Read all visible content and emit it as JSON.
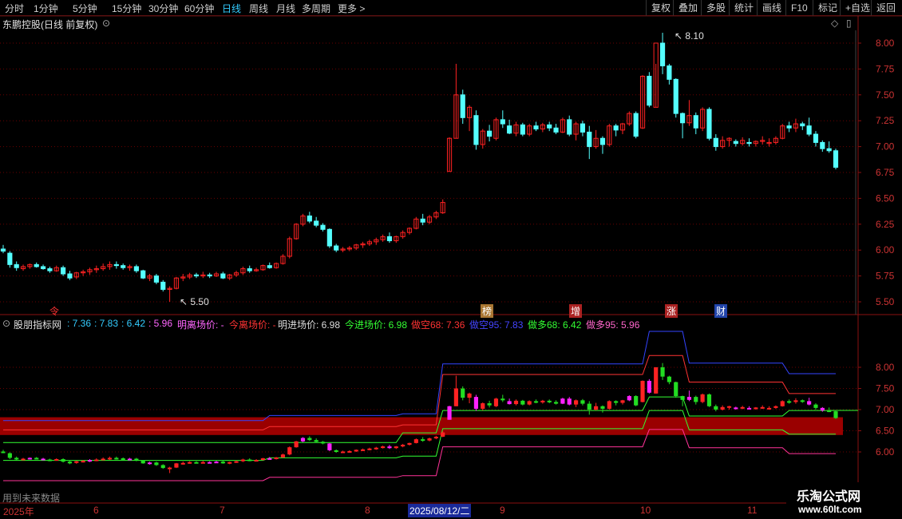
{
  "toolbar": {
    "periods": [
      "分时",
      "1分钟",
      "5分钟",
      "15分钟",
      "30分钟",
      "60分钟",
      "日线",
      "周线",
      "月线",
      "多周期",
      "更多 >"
    ],
    "active_period": "日线",
    "right_buttons": [
      "复权",
      "叠加",
      "多股",
      "统计",
      "画线",
      "F10",
      "标记",
      "+自选",
      "返回"
    ]
  },
  "main_title": "东鹏控股(日线 前复权)",
  "indicator": {
    "name": "股朋指标网",
    "v1": ": 7.36",
    "v2": ": 7.83",
    "v3": ": 6.42",
    "v4": ": 5.96",
    "items": [
      {
        "label": "明离场价: -",
        "color": "#ff66ff"
      },
      {
        "label": "今离场价: -",
        "color": "#ff3333"
      },
      {
        "label": "明进场价: 6.98",
        "color": "#dddddd"
      },
      {
        "label": "今进场价: 6.98",
        "color": "#33ff33"
      },
      {
        "label": "做空68: 7.36",
        "color": "#ff3333"
      },
      {
        "label": "做空95: 7.83",
        "color": "#4444ff"
      },
      {
        "label": "做多68: 6.42",
        "color": "#33ff33"
      },
      {
        "label": "做多95: 5.96",
        "color": "#ff66cc"
      }
    ]
  },
  "price_axis": [
    "8.00",
    "7.75",
    "7.50",
    "7.25",
    "7.00",
    "6.75",
    "6.50",
    "6.25",
    "6.00",
    "5.75",
    "5.50"
  ],
  "ind_axis": [
    "8.00",
    "7.50",
    "7.00",
    "6.50",
    "6.00"
  ],
  "annotations": {
    "high": "8.10",
    "low": "5.50"
  },
  "markers": [
    {
      "text": "令",
      "color": "#ff3333",
      "bg": ""
    },
    {
      "text": "榜",
      "color": "#ffffff",
      "bg": "#aa7733"
    },
    {
      "text": "增",
      "color": "#ffffff",
      "bg": "#aa2222"
    },
    {
      "text": "涨",
      "color": "#ffffff",
      "bg": "#aa2222"
    },
    {
      "text": "财",
      "color": "#ffffff",
      "bg": "#2244aa"
    }
  ],
  "future_note": "用到未来数据",
  "date_axis": [
    "2025年",
    "6",
    "7",
    "8",
    "2025/08/12/二",
    "9",
    "10",
    "11"
  ],
  "watermark": {
    "line1": "乐淘公式网",
    "line2": "www.60lt.com"
  },
  "colors": {
    "up": "#ff2222",
    "down": "#54ffff",
    "grid": "#6a0000",
    "band": "#9a0000",
    "active": "#33ccff"
  },
  "chart_data": {
    "type": "candlestick",
    "candles": [
      [
        6.01,
        6.05,
        5.97,
        5.99
      ],
      [
        5.97,
        5.99,
        5.83,
        5.86
      ],
      [
        5.86,
        5.89,
        5.8,
        5.83
      ],
      [
        5.82,
        5.86,
        5.8,
        5.84
      ],
      [
        5.84,
        5.87,
        5.82,
        5.86
      ],
      [
        5.86,
        5.88,
        5.83,
        5.84
      ],
      [
        5.84,
        5.86,
        5.81,
        5.82
      ],
      [
        5.82,
        5.84,
        5.78,
        5.8
      ],
      [
        5.8,
        5.85,
        5.79,
        5.83
      ],
      [
        5.83,
        5.85,
        5.75,
        5.77
      ],
      [
        5.77,
        5.8,
        5.71,
        5.73
      ],
      [
        5.74,
        5.79,
        5.72,
        5.78
      ],
      [
        5.78,
        5.81,
        5.75,
        5.79
      ],
      [
        5.79,
        5.83,
        5.76,
        5.81
      ],
      [
        5.81,
        5.85,
        5.78,
        5.82
      ],
      [
        5.82,
        5.87,
        5.8,
        5.84
      ],
      [
        5.84,
        5.89,
        5.81,
        5.86
      ],
      [
        5.86,
        5.89,
        5.82,
        5.85
      ],
      [
        5.85,
        5.87,
        5.81,
        5.83
      ],
      [
        5.83,
        5.86,
        5.8,
        5.84
      ],
      [
        5.84,
        5.86,
        5.78,
        5.8
      ],
      [
        5.8,
        5.81,
        5.72,
        5.73
      ],
      [
        5.73,
        5.77,
        5.7,
        5.75
      ],
      [
        5.75,
        5.77,
        5.67,
        5.69
      ],
      [
        5.69,
        5.71,
        5.6,
        5.62
      ],
      [
        5.62,
        5.65,
        5.5,
        5.63
      ],
      [
        5.63,
        5.74,
        5.62,
        5.73
      ],
      [
        5.73,
        5.77,
        5.7,
        5.74
      ],
      [
        5.74,
        5.78,
        5.72,
        5.76
      ],
      [
        5.76,
        5.78,
        5.73,
        5.75
      ],
      [
        5.75,
        5.79,
        5.73,
        5.76
      ],
      [
        5.76,
        5.78,
        5.73,
        5.75
      ],
      [
        5.75,
        5.79,
        5.74,
        5.77
      ],
      [
        5.77,
        5.79,
        5.72,
        5.73
      ],
      [
        5.73,
        5.77,
        5.71,
        5.76
      ],
      [
        5.76,
        5.8,
        5.74,
        5.78
      ],
      [
        5.78,
        5.84,
        5.76,
        5.82
      ],
      [
        5.82,
        5.85,
        5.78,
        5.8
      ],
      [
        5.8,
        5.83,
        5.79,
        5.81
      ],
      [
        5.81,
        5.86,
        5.8,
        5.85
      ],
      [
        5.85,
        5.88,
        5.82,
        5.83
      ],
      [
        5.83,
        5.88,
        5.82,
        5.87
      ],
      [
        5.87,
        5.96,
        5.86,
        5.94
      ],
      [
        5.94,
        6.13,
        5.92,
        6.11
      ],
      [
        6.11,
        6.26,
        6.1,
        6.25
      ],
      [
        6.25,
        6.35,
        6.23,
        6.33
      ],
      [
        6.33,
        6.37,
        6.26,
        6.28
      ],
      [
        6.28,
        6.32,
        6.22,
        6.24
      ],
      [
        6.24,
        6.26,
        6.18,
        6.2
      ],
      [
        6.2,
        6.21,
        6.02,
        6.04
      ],
      [
        6.04,
        6.06,
        5.98,
        6.0
      ],
      [
        6.0,
        6.03,
        5.98,
        6.01
      ],
      [
        6.01,
        6.04,
        5.99,
        6.02
      ],
      [
        6.02,
        6.06,
        6.0,
        6.05
      ],
      [
        6.05,
        6.08,
        6.02,
        6.06
      ],
      [
        6.06,
        6.1,
        6.04,
        6.08
      ],
      [
        6.08,
        6.12,
        6.05,
        6.1
      ],
      [
        6.1,
        6.15,
        6.08,
        6.13
      ],
      [
        6.13,
        6.17,
        6.07,
        6.09
      ],
      [
        6.09,
        6.14,
        6.07,
        6.13
      ],
      [
        6.13,
        6.19,
        6.11,
        6.17
      ],
      [
        6.17,
        6.22,
        6.15,
        6.21
      ],
      [
        6.21,
        6.32,
        6.2,
        6.3
      ],
      [
        6.3,
        6.35,
        6.24,
        6.27
      ],
      [
        6.27,
        6.34,
        6.25,
        6.32
      ],
      [
        6.32,
        6.38,
        6.3,
        6.36
      ],
      [
        6.36,
        6.49,
        6.35,
        6.46
      ],
      [
        6.76,
        7.09,
        6.76,
        7.08
      ],
      [
        7.08,
        7.8,
        7.08,
        7.5
      ],
      [
        7.5,
        7.55,
        7.22,
        7.28
      ],
      [
        7.28,
        7.4,
        7.15,
        7.38
      ],
      [
        7.3,
        7.35,
        6.97,
        7.02
      ],
      [
        7.02,
        7.17,
        6.98,
        7.15
      ],
      [
        7.15,
        7.21,
        7.05,
        7.1
      ],
      [
        7.08,
        7.28,
        7.06,
        7.26
      ],
      [
        7.26,
        7.35,
        7.18,
        7.22
      ],
      [
        7.2,
        7.26,
        7.12,
        7.13
      ],
      [
        7.13,
        7.24,
        7.1,
        7.21
      ],
      [
        7.21,
        7.23,
        7.1,
        7.12
      ],
      [
        7.12,
        7.22,
        7.1,
        7.2
      ],
      [
        7.2,
        7.24,
        7.15,
        7.17
      ],
      [
        7.17,
        7.23,
        7.14,
        7.21
      ],
      [
        7.21,
        7.24,
        7.15,
        7.18
      ],
      [
        7.18,
        7.22,
        7.12,
        7.14
      ],
      [
        7.14,
        7.28,
        7.13,
        7.26
      ],
      [
        7.26,
        7.3,
        7.1,
        7.12
      ],
      [
        7.12,
        7.24,
        7.06,
        7.22
      ],
      [
        7.22,
        7.25,
        7.1,
        7.14
      ],
      [
        7.14,
        7.2,
        6.88,
        7.0
      ],
      [
        7.0,
        7.16,
        6.98,
        7.08
      ],
      [
        7.08,
        7.1,
        6.93,
        7.02
      ],
      [
        7.02,
        7.22,
        7.0,
        7.2
      ],
      [
        7.2,
        7.22,
        7.1,
        7.16
      ],
      [
        7.16,
        7.23,
        7.12,
        7.22
      ],
      [
        7.22,
        7.34,
        7.2,
        7.32
      ],
      [
        7.32,
        7.34,
        7.08,
        7.1
      ],
      [
        7.18,
        7.69,
        7.17,
        7.68
      ],
      [
        7.68,
        7.72,
        7.38,
        7.4
      ],
      [
        7.38,
        7.8,
        7.38,
        8.0
      ],
      [
        8.0,
        8.1,
        7.7,
        7.78
      ],
      [
        7.78,
        7.8,
        7.6,
        7.65
      ],
      [
        7.65,
        7.66,
        7.28,
        7.32
      ],
      [
        7.32,
        7.33,
        7.08,
        7.23
      ],
      [
        7.23,
        7.45,
        7.2,
        7.3
      ],
      [
        7.3,
        7.33,
        7.12,
        7.18
      ],
      [
        7.18,
        7.38,
        7.15,
        7.36
      ],
      [
        7.36,
        7.38,
        7.06,
        7.08
      ],
      [
        7.08,
        7.12,
        6.96,
        7.0
      ],
      [
        7.0,
        7.1,
        6.98,
        7.06
      ],
      [
        7.06,
        7.09,
        7.0,
        7.08
      ],
      [
        7.05,
        7.07,
        7.0,
        7.03
      ],
      [
        7.03,
        7.09,
        7.01,
        7.06
      ],
      [
        7.04,
        7.08,
        7.0,
        7.03
      ],
      [
        7.03,
        7.06,
        7.0,
        7.05
      ],
      [
        7.05,
        7.1,
        7.02,
        7.06
      ],
      [
        7.03,
        7.08,
        7.0,
        7.04
      ],
      [
        7.04,
        7.1,
        7.02,
        7.08
      ],
      [
        7.08,
        7.22,
        7.07,
        7.2
      ],
      [
        7.2,
        7.24,
        7.14,
        7.18
      ],
      [
        7.18,
        7.27,
        7.14,
        7.22
      ],
      [
        7.22,
        7.24,
        7.16,
        7.2
      ],
      [
        7.2,
        7.28,
        7.1,
        7.12
      ],
      [
        7.12,
        7.15,
        7.0,
        7.04
      ],
      [
        7.04,
        7.06,
        6.95,
        6.98
      ],
      [
        6.98,
        7.05,
        6.94,
        6.96
      ],
      [
        6.96,
        6.98,
        6.78,
        6.8
      ]
    ],
    "high_label": "8.10",
    "low_label": "5.50"
  }
}
